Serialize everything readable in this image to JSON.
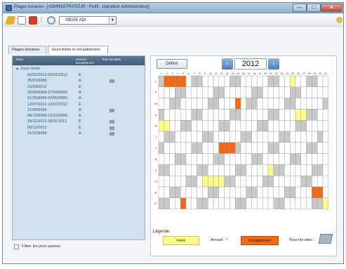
{
  "window": {
    "title": "Plages horaires - [ADMINISTRATEUR : Profil : opérateur Administrateur]",
    "minimize": "—",
    "maximize": "□",
    "close": "✕"
  },
  "toolbar": {
    "site_select_value": "SIEGE ADI",
    "dropdown_glyph": "▾",
    "separator": "|"
  },
  "tabs": [
    {
      "label": "Plages Horaires"
    },
    {
      "label": "Jours fériés et exceptionnels"
    }
  ],
  "tree": {
    "headers": {
      "col1": "Jours",
      "col2": "Annuel / Exceptionnel",
      "col3": "Tous les sites"
    },
    "group": "▲ Jours fériés",
    "rows": [
      {
        "date": "02/01/2012-05/01/2012",
        "type": "E",
        "all_sites": false
      },
      {
        "date": "25/01/9999",
        "type": "A",
        "all_sites": true
      },
      {
        "date": "15/03/2012",
        "type": "E",
        "all_sites": false
      },
      {
        "date": "26/04/9999-27/04/9999",
        "type": "A",
        "all_sites": false
      },
      {
        "date": "01/05/9999-02/05/9999",
        "type": "A",
        "all_sites": false
      },
      {
        "date": "12/07/2012-14/07/2012",
        "type": "E",
        "all_sites": false
      },
      {
        "date": "21/09/9999",
        "type": "A",
        "all_sites": true
      },
      {
        "date": "09/10/9999-12/10/9999",
        "type": "A",
        "all_sites": false
      },
      {
        "date": "29/11/2012-30/11/2012",
        "type": "E",
        "all_sites": true
      },
      {
        "date": "05/12/2012",
        "type": "E",
        "all_sites": true
      },
      {
        "date": "31/12/9999",
        "type": "A",
        "all_sites": true
      }
    ]
  },
  "filter": {
    "label": "Filtrer les jours passés"
  },
  "calendar": {
    "define_button": "Définir",
    "year": "2012",
    "prev_glyph": "‹",
    "next_glyph": "›",
    "month_labels": [
      "J",
      "F",
      "M",
      "A",
      "M",
      "J",
      "J",
      "A",
      "S",
      "O",
      "N",
      "D"
    ],
    "colors": {
      "ferie": "#fdfa8b",
      "exceptionnel": "#ee6a17",
      "weekend": "#c8c8c8",
      "grid": "#9a9a9a"
    },
    "holidays": [
      {
        "month": 1,
        "day": 2,
        "kind": "exceptionnel"
      },
      {
        "month": 1,
        "day": 3,
        "kind": "exceptionnel"
      },
      {
        "month": 1,
        "day": 4,
        "kind": "exceptionnel"
      },
      {
        "month": 1,
        "day": 5,
        "kind": "exceptionnel"
      },
      {
        "month": 1,
        "day": 25,
        "kind": "ferie"
      },
      {
        "month": 3,
        "day": 15,
        "kind": "exceptionnel"
      },
      {
        "month": 4,
        "day": 26,
        "kind": "ferie"
      },
      {
        "month": 4,
        "day": 27,
        "kind": "ferie"
      },
      {
        "month": 5,
        "day": 1,
        "kind": "ferie"
      },
      {
        "month": 5,
        "day": 2,
        "kind": "ferie"
      },
      {
        "month": 7,
        "day": 12,
        "kind": "exceptionnel"
      },
      {
        "month": 7,
        "day": 13,
        "kind": "exceptionnel"
      },
      {
        "month": 7,
        "day": 14,
        "kind": "exceptionnel"
      },
      {
        "month": 9,
        "day": 21,
        "kind": "ferie"
      },
      {
        "month": 10,
        "day": 9,
        "kind": "ferie"
      },
      {
        "month": 10,
        "day": 10,
        "kind": "ferie"
      },
      {
        "month": 10,
        "day": 11,
        "kind": "ferie"
      },
      {
        "month": 10,
        "day": 12,
        "kind": "ferie"
      },
      {
        "month": 11,
        "day": 29,
        "kind": "exceptionnel"
      },
      {
        "month": 11,
        "day": 30,
        "kind": "exceptionnel"
      },
      {
        "month": 12,
        "day": 5,
        "kind": "exceptionnel"
      },
      {
        "month": 12,
        "day": 31,
        "kind": "ferie"
      }
    ]
  },
  "legend": {
    "title": "Légende",
    "ferie": "Férié",
    "annuel": "Annuel : *",
    "exceptionnel": "Exceptionnel",
    "tous_sites": "Tous les sites :"
  }
}
